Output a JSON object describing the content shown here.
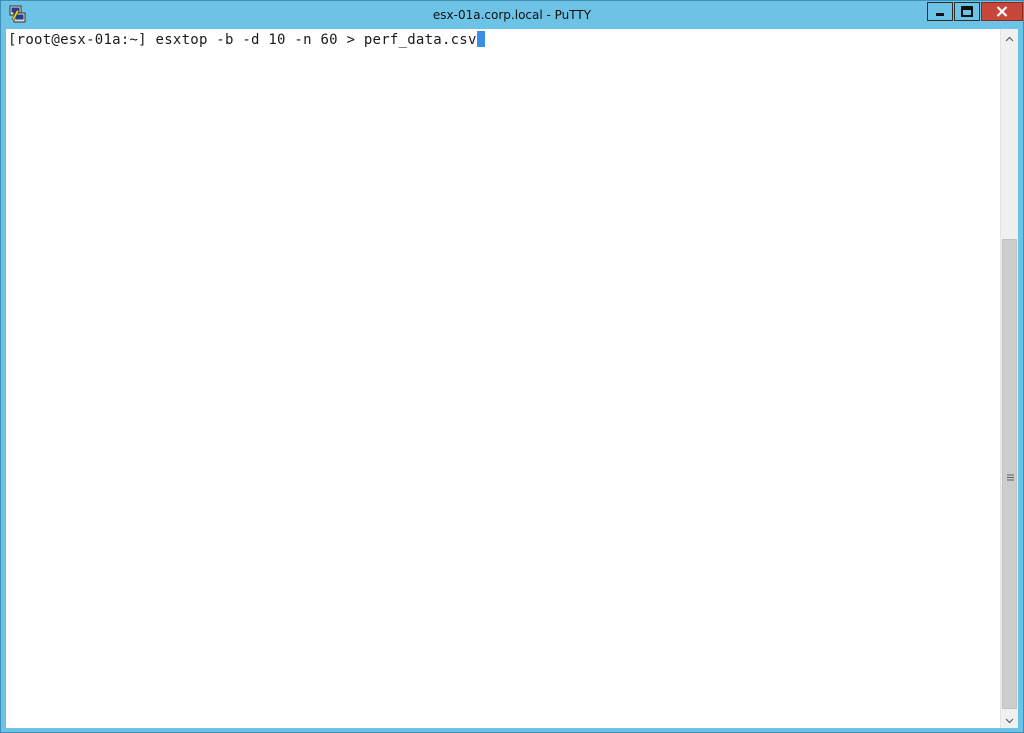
{
  "window": {
    "title": "esx-01a.corp.local - PuTTY",
    "titlebar_color": "#6cc3e6",
    "close_color": "#c7473a"
  },
  "icons": {
    "app": "putty-icon",
    "minimize": "minimize-icon",
    "maximize": "maximize-icon",
    "close": "close-icon",
    "scroll_up": "chevron-up-icon",
    "scroll_down": "chevron-down-icon",
    "grip": "scroll-grip-icon"
  },
  "terminal": {
    "prompt": "[root@esx-01a:~] ",
    "command": "esxtop -b -d 10 -n 60 > perf_data.csv",
    "cursor_color": "#3b8ee8"
  }
}
